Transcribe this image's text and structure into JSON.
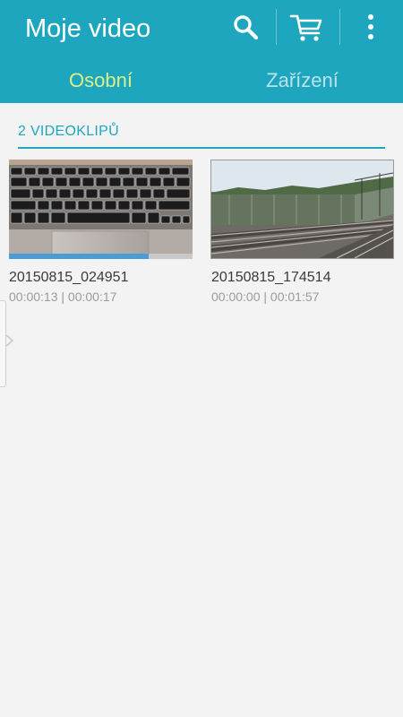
{
  "header": {
    "title": "Moje video",
    "actions": {
      "search_icon": "search-icon",
      "cart_icon": "shopping-cart-icon",
      "more_icon": "more-vertical-icon"
    },
    "tabs": [
      {
        "label": "Osobní",
        "selected": true
      },
      {
        "label": "Zařízení",
        "selected": false
      }
    ]
  },
  "section": {
    "header": "2 VIDEOKLIPŮ"
  },
  "videos": [
    {
      "name": "20150815_024951",
      "time": "00:00:13 | 00:00:17",
      "thumbnail": "keyboard",
      "progress": 0.76
    },
    {
      "name": "20150815_174514",
      "time": "00:00:00 | 00:01:57",
      "thumbnail": "railway"
    }
  ],
  "colors": {
    "accent": "#1ea6be",
    "tab_selected": "#d9f08a",
    "tab_unselected": "#b9e3ec",
    "progress": "#4a9cd6"
  }
}
